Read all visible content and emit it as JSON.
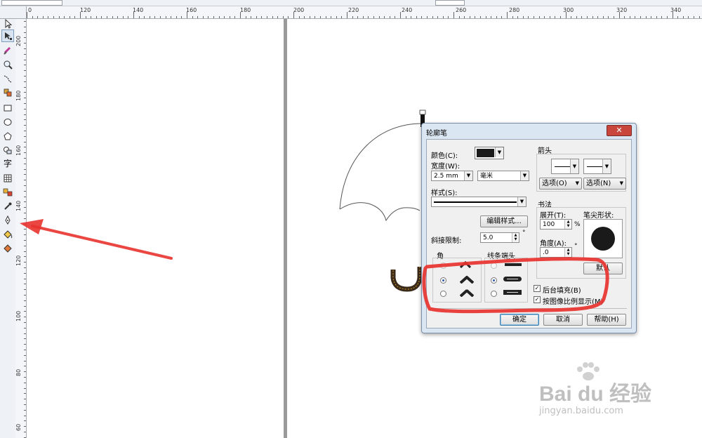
{
  "rulers": {
    "horizontal_labels": [
      "0",
      "120",
      "140",
      "160",
      "180",
      "200",
      "220",
      "240",
      "260",
      "280",
      "300",
      "320",
      "340"
    ],
    "vertical_labels": [
      "200",
      "180",
      "160",
      "140",
      "120",
      "100",
      "80",
      "60"
    ]
  },
  "toolbox": {
    "text_tool_glyph": "字",
    "tools": [
      "pick-tool-icon",
      "shape-tool-icon",
      "crop-tool-icon",
      "zoom-tool-icon",
      "freehand-tool-icon",
      "smart-fill-icon",
      "rectangle-tool-icon",
      "ellipse-tool-icon",
      "polygon-tool-icon",
      "basic-shapes-icon",
      "text-tool-icon",
      "table-tool-icon",
      "blend-tool-icon",
      "eyedropper-tool-icon",
      "outline-pen-tool-icon",
      "fill-tool-icon",
      "interactive-fill-icon"
    ]
  },
  "dialog": {
    "title": "轮廓笔",
    "close_glyph": "✕",
    "color_label": "颜色(C):",
    "color_value": "#1a1a1a",
    "width_label": "宽度(W):",
    "width_value": "2.5 mm",
    "units_value": "毫米",
    "style_label": "样式(S):",
    "edit_style_button": "编辑样式...",
    "miter_label": "斜接限制:",
    "miter_value": "5.0",
    "miter_unit": "°",
    "corners_label": "角",
    "line_caps_label": "线条端头",
    "arrows_label": "箭头",
    "options_left": "选项(O)",
    "options_right": "选项(N)",
    "calligraphy_label": "书法",
    "stretch_label": "展开(T):",
    "stretch_value": "100",
    "stretch_unit": "%",
    "angle_label": "角度(A):",
    "angle_value": ".0",
    "angle_unit": "°",
    "nib_shape_label": "笔尖形状:",
    "default_button": "默认",
    "behind_fill_label": "后台填充(B)",
    "behind_fill_checked": true,
    "scale_with_image_label": "按图像比例显示(M)",
    "scale_with_image_checked": true,
    "ok_button": "确定",
    "cancel_button": "取消",
    "help_button": "帮助(H)"
  },
  "annotation": {
    "color": "#e8332f"
  },
  "watermark": {
    "brand": "Bai du 经验",
    "url": "jingyan.baidu.com"
  }
}
